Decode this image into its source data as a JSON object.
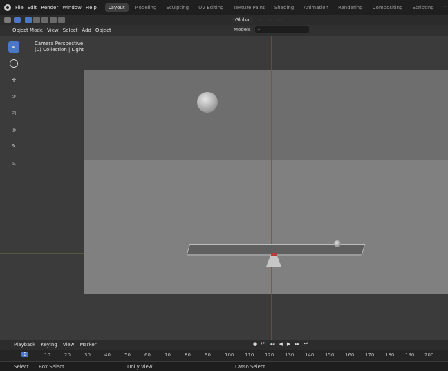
{
  "topbar": {
    "menu": [
      "File",
      "Edit",
      "Render",
      "Window",
      "Help"
    ],
    "workspaces": [
      "Layout",
      "Modeling",
      "Sculpting",
      "UV Editing",
      "Texture Paint",
      "Shading",
      "Animation",
      "Rendering",
      "Compositing",
      "Scripting"
    ],
    "active_workspace": "Layout",
    "plus_label": "+"
  },
  "header2": {
    "center": {
      "transform_orientation": "Global",
      "pivot_label": "",
      "snap_label": "",
      "proportional_label": ""
    }
  },
  "header3": {
    "mode_label": "Object Mode",
    "menus": [
      "View",
      "Select",
      "Add",
      "Object"
    ],
    "right": {
      "models_label": "Models",
      "search_placeholder": ""
    }
  },
  "viewport": {
    "overlay": {
      "line1": "Camera Perspective",
      "line2": "(0) Collection | Light"
    }
  },
  "timeline": {
    "menus": [
      "Playback",
      "Keying",
      "View",
      "Marker"
    ],
    "frames": [
      "0",
      "10",
      "20",
      "30",
      "40",
      "50",
      "60",
      "70",
      "80",
      "90",
      "100",
      "110",
      "120",
      "130",
      "140",
      "150",
      "160",
      "170",
      "180",
      "190",
      "200"
    ],
    "current_frame": "0"
  },
  "statusbar": {
    "items": [
      "Select",
      "Box Select",
      "Dolly View",
      "Lasso Select"
    ]
  },
  "colors": {
    "accent": "#4a78c6",
    "topbar_bg": "#1f1f1f",
    "viewport_bg": "#3b3b3b",
    "scene_bg": "#808080",
    "axis_red": "#b03636"
  }
}
